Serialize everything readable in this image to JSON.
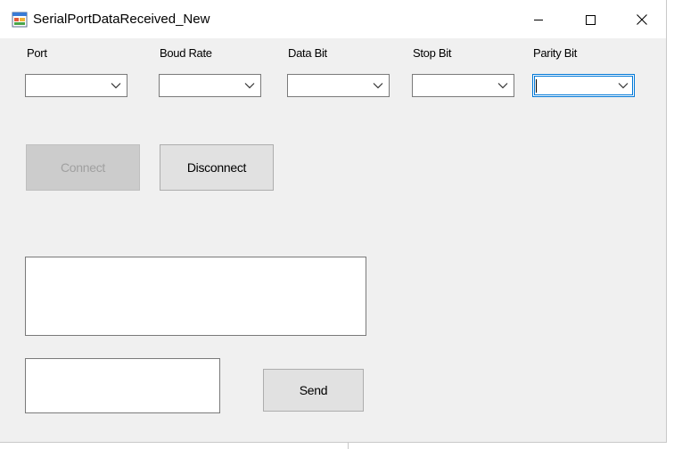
{
  "window": {
    "title": "SerialPortDataReceived_New",
    "controls": {
      "minimize": "minimize",
      "maximize": "maximize",
      "close": "close"
    }
  },
  "settings": {
    "port": {
      "label": "Port",
      "value": ""
    },
    "baud_rate": {
      "label": "Boud Rate",
      "value": ""
    },
    "data_bit": {
      "label": "Data Bit",
      "value": ""
    },
    "stop_bit": {
      "label": "Stop Bit",
      "value": ""
    },
    "parity_bit": {
      "label": "Parity Bit",
      "value": ""
    }
  },
  "actions": {
    "connect_label": "Connect",
    "connect_enabled": false,
    "disconnect_label": "Disconnect",
    "send_label": "Send"
  },
  "received": {
    "text": ""
  },
  "outgoing": {
    "text": ""
  },
  "colors": {
    "form_background": "#f0f0f0",
    "focus_border": "#0078d7",
    "button_face": "#e1e1e1",
    "disabled_button": "#cccccc"
  }
}
